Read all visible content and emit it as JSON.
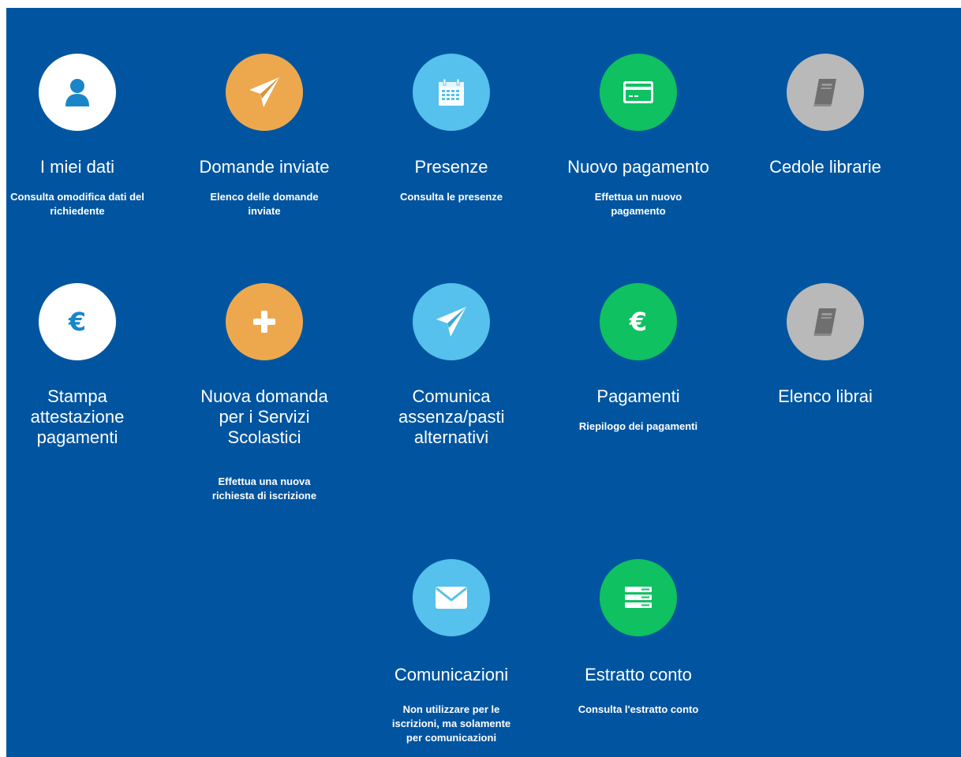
{
  "colors": {
    "background": "#0155a0",
    "white": "#ffffff",
    "orange": "#eda84d",
    "sky": "#55c1ec",
    "green": "#0fc160",
    "gray": "#b9b9b9"
  },
  "tiles": [
    {
      "title": "I miei dati",
      "desc": "Consulta omodifica dati del richiedente",
      "icon": "user-icon"
    },
    {
      "title": "Domande inviate",
      "desc": "Elenco delle domande inviate",
      "icon": "paper-plane-icon"
    },
    {
      "title": "Presenze",
      "desc": "Consulta le presenze",
      "icon": "calendar-icon"
    },
    {
      "title": "Nuovo pagamento",
      "desc": "Effettua un nuovo pagamento",
      "icon": "credit-card-icon"
    },
    {
      "title": "Cedole librarie",
      "desc": "",
      "icon": "book-icon"
    },
    {
      "title": "Stampa attestazione pagamenti",
      "desc": "",
      "icon": "euro-icon"
    },
    {
      "title": "Nuova domanda per i Servizi Scolastici",
      "desc": "Effettua una nuova richiesta di iscrizione",
      "icon": "plus-icon"
    },
    {
      "title": "Comunica assenza/pasti alternativi",
      "desc": "",
      "icon": "paper-plane-icon"
    },
    {
      "title": "Pagamenti",
      "desc": "Riepilogo dei pagamenti",
      "icon": "euro-icon"
    },
    {
      "title": "Elenco librai",
      "desc": "",
      "icon": "book-icon"
    },
    {
      "title": "Comunicazioni",
      "desc": "Non utilizzare per le iscrizioni, ma solamente per comunicazioni",
      "icon": "envelope-icon"
    },
    {
      "title": "Estratto conto",
      "desc": "Consulta l'estratto conto",
      "icon": "server-list-icon"
    }
  ]
}
